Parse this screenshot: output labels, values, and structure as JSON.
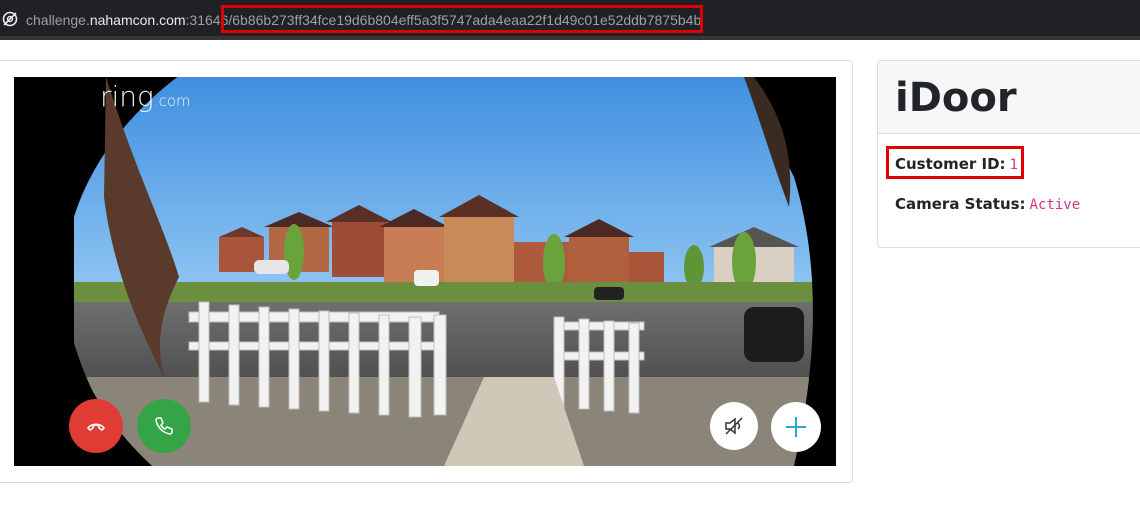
{
  "browser": {
    "url_prefix": "challenge.",
    "url_host": "nahamcon.com",
    "url_port": ":31646",
    "url_path": "/6b86b273ff34fce19d6b804eff5a3f5747ada4eaa22f1d49c01e52ddb7875b4b"
  },
  "camera": {
    "brand": "ring",
    "brand_suffix": ".com",
    "buttons": {
      "hangup_icon": "phone-hangup-icon",
      "answer_icon": "phone-icon",
      "mute_icon": "speaker-muted-icon",
      "add_icon": "plus-icon"
    },
    "colors": {
      "hangup": "#e03c34",
      "answer": "#35a447",
      "plus": "#2aa7c9"
    }
  },
  "info": {
    "title": "iDoor",
    "customer_id_label": "Customer ID:",
    "customer_id_value": "1",
    "camera_status_label": "Camera Status:",
    "camera_status_value": "Active"
  },
  "highlight_color": "#e00000"
}
